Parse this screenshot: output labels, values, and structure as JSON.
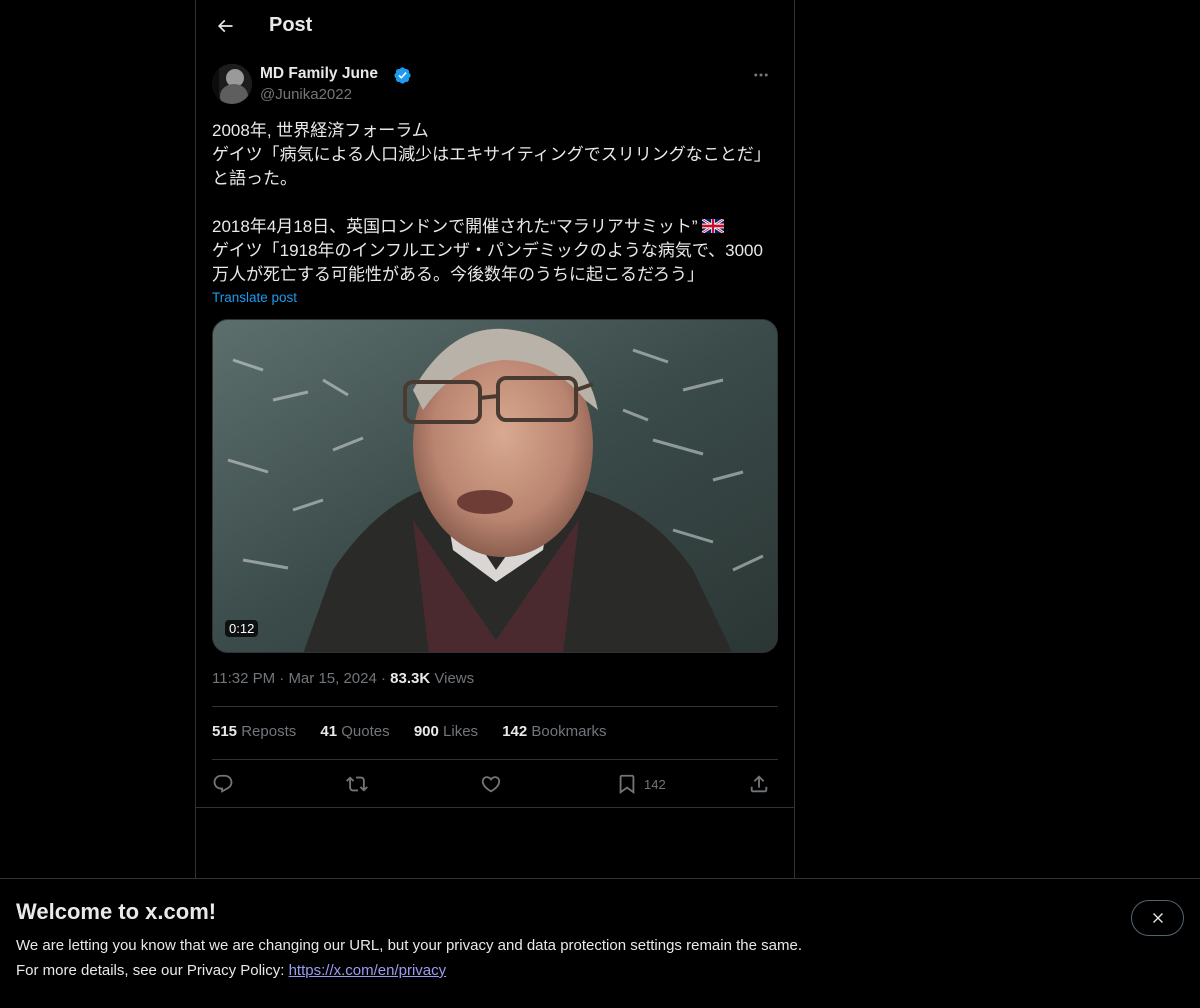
{
  "header": {
    "title": "Post"
  },
  "author": {
    "name": "MD Family June",
    "handle": "@Junika2022"
  },
  "tweet": {
    "text_part1": "2008年, 世界経済フォーラム\nゲイツ「病気による人口減少はエキサイティングでスリリングなことだ」と語った。\n\n2018年4月18日、英国ロンドンで開催された“マラリアサミット”",
    "text_part2": "\nゲイツ「1918年のインフルエンザ・パンデミックのような病気で、3000万人が死亡する可能性がある。今後数年のうちに起こるだろう」",
    "translate_label": "Translate post",
    "video_duration": "0:12"
  },
  "meta": {
    "time": "11:32 PM",
    "date": "Mar 15, 2024",
    "views_count": "83.3K",
    "views_label": "Views",
    "separator": "·"
  },
  "stats": {
    "reposts_count": "515",
    "reposts_label": "Reposts",
    "quotes_count": "41",
    "quotes_label": "Quotes",
    "likes_count": "900",
    "likes_label": "Likes",
    "bookmarks_count": "142",
    "bookmarks_label": "Bookmarks"
  },
  "actions": {
    "bookmark_count": "142"
  },
  "banner": {
    "title": "Welcome to x.com!",
    "line1": "We are letting you know that we are changing our URL, but your privacy and data protection settings remain the same.",
    "line2_prefix": "For more details, see our Privacy Policy: ",
    "link": "https://x.com/en/privacy"
  },
  "colors": {
    "accent": "#1d9bf0",
    "secondary_text": "#71767b",
    "border": "#2f3336",
    "link_banner": "#9b9bf5"
  },
  "icons": {
    "back": "arrow-left-icon",
    "verified": "verified-badge-icon",
    "more": "more-horizontal-icon",
    "reply": "reply-icon",
    "repost": "repost-icon",
    "like": "heart-icon",
    "bookmark": "bookmark-icon",
    "share": "share-icon",
    "close": "close-icon",
    "flag": "uk-flag-icon"
  }
}
